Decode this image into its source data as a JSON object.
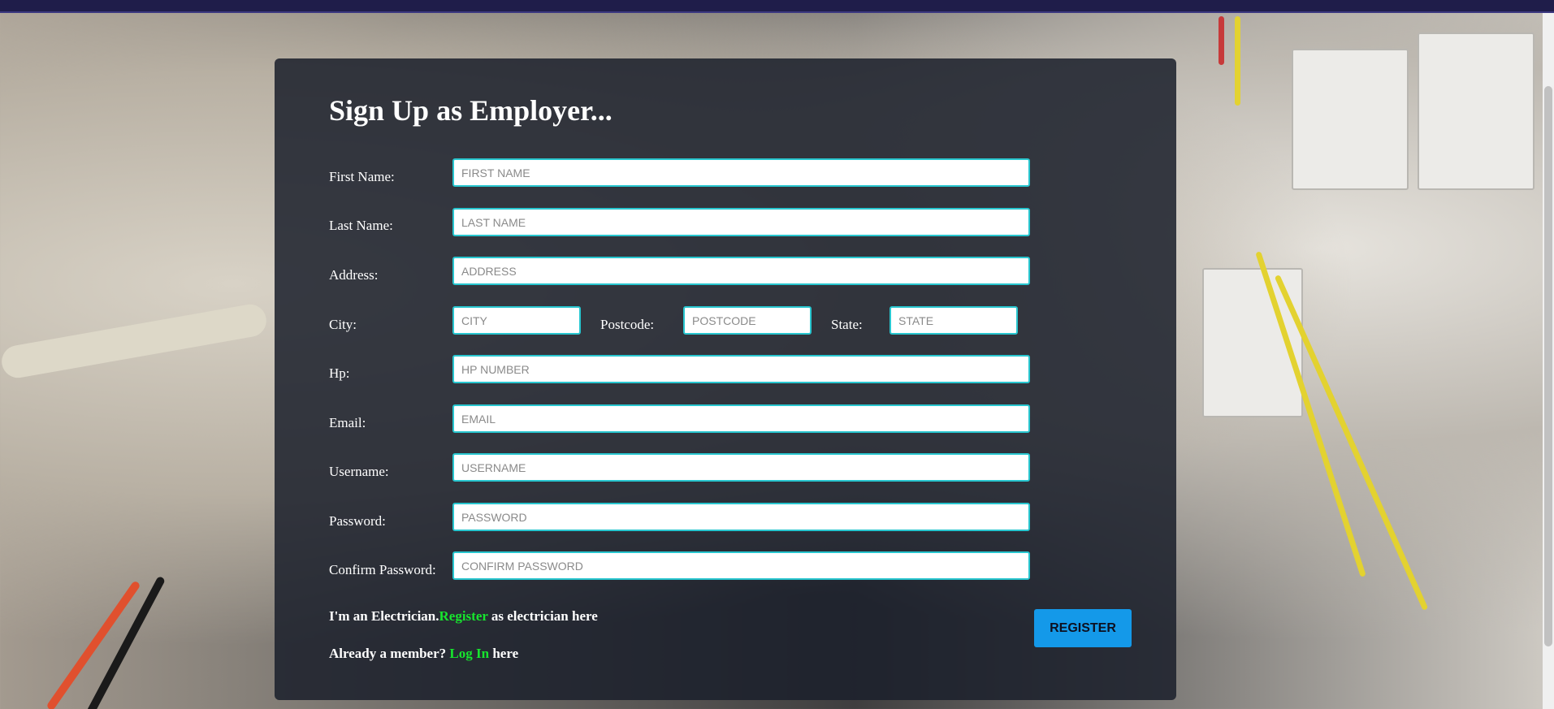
{
  "form": {
    "title": "Sign Up as Employer...",
    "fields": {
      "first_name": {
        "label": "First Name:",
        "placeholder": "FIRST NAME"
      },
      "last_name": {
        "label": "Last Name:",
        "placeholder": "LAST NAME"
      },
      "address": {
        "label": "Address:",
        "placeholder": "ADDRESS"
      },
      "city": {
        "label": "City:",
        "placeholder": "CITY"
      },
      "postcode": {
        "label": "Postcode:",
        "placeholder": "POSTCODE"
      },
      "state": {
        "label": "State:",
        "placeholder": "STATE"
      },
      "hp": {
        "label": "Hp:",
        "placeholder": "HP NUMBER"
      },
      "email": {
        "label": "Email:",
        "placeholder": "EMAIL"
      },
      "username": {
        "label": "Username:",
        "placeholder": "USERNAME"
      },
      "password": {
        "label": "Password:",
        "placeholder": "PASSWORD"
      },
      "confirm_password": {
        "label": "Confirm Password:",
        "placeholder": "CONFIRM PASSWORD"
      }
    },
    "electrician_note": {
      "prefix": "I'm an Electrician.",
      "link": "Register",
      "suffix": " as electrician here"
    },
    "member_note": {
      "prefix": "Already a member? ",
      "link": "Log In",
      "suffix": " here"
    },
    "register_button": "REGISTER"
  },
  "colors": {
    "input_border": "#28c6cf",
    "link_green": "#17e52e",
    "button_blue": "#1499e9",
    "card_bg": "#1b1f2b",
    "top_bar": "#1f1d4a"
  }
}
